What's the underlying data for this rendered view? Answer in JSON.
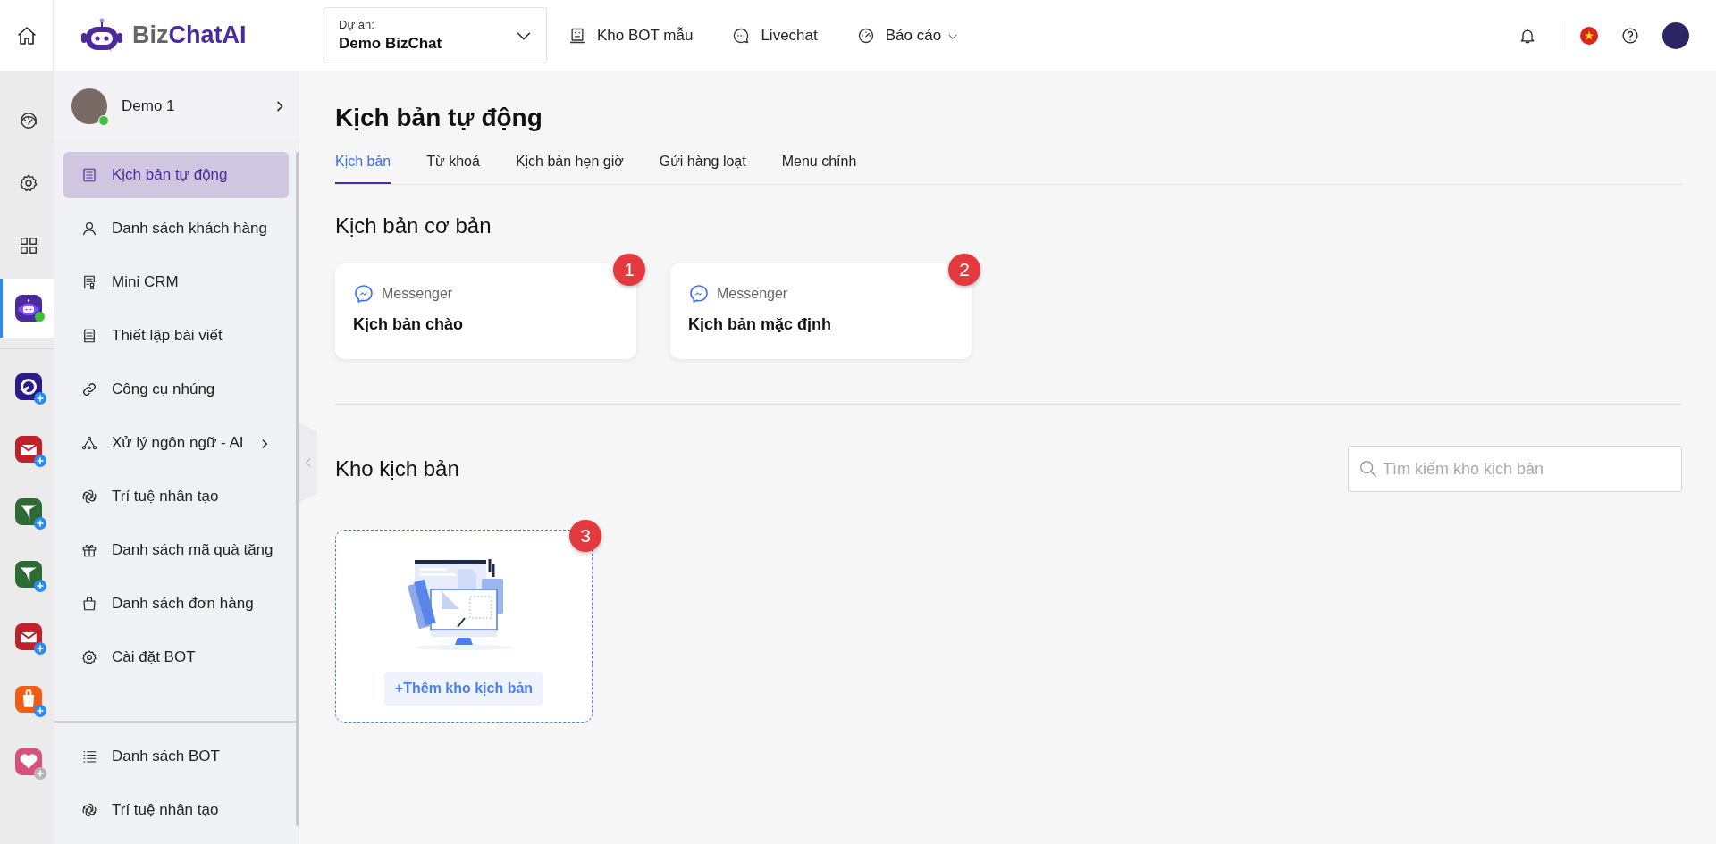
{
  "logo": {
    "parts": [
      "Biz",
      "ChatAI"
    ]
  },
  "project": {
    "label": "Dự án:",
    "value": "Demo BizChat"
  },
  "top_nav": [
    {
      "kind": "template",
      "label": "Kho BOT mẫu",
      "dropdown": false
    },
    {
      "kind": "chat",
      "label": "Livechat",
      "dropdown": false
    },
    {
      "kind": "report",
      "label": "Báo cáo",
      "dropdown": true
    }
  ],
  "rail": [
    {
      "kind": "dashboard",
      "selected": false
    },
    {
      "kind": "settings",
      "selected": false
    },
    {
      "kind": "grid",
      "selected": false
    },
    {
      "kind": "bot",
      "selected": true
    }
  ],
  "rail_apps": [
    {
      "kind": "send",
      "color": "#2a1a8c",
      "disabled": false
    },
    {
      "kind": "mail",
      "color": "#c0202a",
      "disabled": false
    },
    {
      "kind": "plane",
      "color": "#2e6b34",
      "disabled": false
    },
    {
      "kind": "plane",
      "color": "#2e6b34",
      "disabled": false
    },
    {
      "kind": "mail",
      "color": "#c0202a",
      "disabled": false
    },
    {
      "kind": "bag",
      "color": "#f25c14",
      "disabled": false
    },
    {
      "kind": "heart",
      "color": "#d9507a",
      "disabled": true
    }
  ],
  "profile": {
    "name": "Demo 1",
    "online": true
  },
  "sidebar": {
    "items": [
      {
        "kind": "list",
        "label": "Kịch bản tự động",
        "selected": true,
        "expandable": false
      },
      {
        "kind": "user",
        "label": "Danh sách khách hàng",
        "selected": false,
        "expandable": false
      },
      {
        "kind": "crm",
        "label": "Mini CRM",
        "selected": false,
        "expandable": false
      },
      {
        "kind": "doc",
        "label": "Thiết lập bài viết",
        "selected": false,
        "expandable": false
      },
      {
        "kind": "link",
        "label": "Công cụ nhúng",
        "selected": false,
        "expandable": false
      },
      {
        "kind": "nodes",
        "label": "Xử lý ngôn ngữ - AI",
        "selected": false,
        "expandable": true
      },
      {
        "kind": "ai",
        "label": "Trí tuệ nhân tạo",
        "selected": false,
        "expandable": false
      },
      {
        "kind": "gift",
        "label": "Danh sách mã quà tặng",
        "selected": false,
        "expandable": false
      },
      {
        "kind": "bag",
        "label": "Danh sách đơn hàng",
        "selected": false,
        "expandable": false
      },
      {
        "kind": "gear",
        "label": "Cài đặt BOT",
        "selected": false,
        "expandable": false
      }
    ],
    "bottom_items": [
      {
        "kind": "bullets",
        "label": "Danh sách BOT",
        "selected": false,
        "expandable": false
      },
      {
        "kind": "ai",
        "label": "Trí tuệ nhân tạo",
        "selected": false,
        "expandable": false
      }
    ]
  },
  "page": {
    "title": "Kịch bản tự động",
    "tabs": [
      {
        "label": "Kịch bản",
        "selected": true
      },
      {
        "label": "Từ khoá",
        "selected": false
      },
      {
        "label": "Kịch bản hẹn giờ",
        "selected": false
      },
      {
        "label": "Gửi hàng loạt",
        "selected": false
      },
      {
        "label": "Menu chính",
        "selected": false
      }
    ],
    "basic_section": {
      "title": "Kịch bản cơ bản",
      "cards": [
        {
          "channel": "Messenger",
          "title": "Kịch bản chào",
          "badge": "1"
        },
        {
          "channel": "Messenger",
          "title": "Kịch bản mặc định",
          "badge": "2"
        }
      ]
    },
    "library_section": {
      "title": "Kho kịch bản",
      "search": {
        "placeholder": "Tìm kiếm kho kịch bản"
      },
      "add_card": {
        "button": "+Thêm kho kịch bản",
        "badge": "3"
      }
    }
  }
}
